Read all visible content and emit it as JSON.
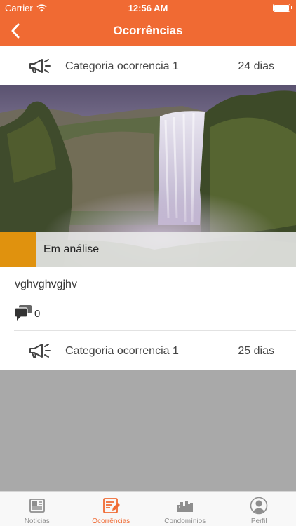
{
  "status_bar": {
    "carrier": "Carrier",
    "time": "12:56 AM"
  },
  "nav": {
    "title": "Ocorrências",
    "back_icon": "chevron-left-icon"
  },
  "feed": {
    "items": [
      {
        "category": "Categoria ocorrencia 1",
        "days": "24 dias",
        "status": "Em análise",
        "description": "vghvghvgjhv",
        "comment_count": "0"
      },
      {
        "category": "Categoria ocorrencia 1",
        "days": "25 dias"
      }
    ]
  },
  "tabs": [
    {
      "label": "Notícias",
      "icon": "newspaper-icon",
      "active": false
    },
    {
      "label": "Ocorrências",
      "icon": "report-edit-icon",
      "active": true
    },
    {
      "label": "Condomínios",
      "icon": "buildings-icon",
      "active": false
    },
    {
      "label": "Perfil",
      "icon": "profile-icon",
      "active": false
    }
  ],
  "colors": {
    "accent": "#f06a33",
    "status_accent": "#e0920e",
    "content_bg": "#a9a9a9"
  }
}
